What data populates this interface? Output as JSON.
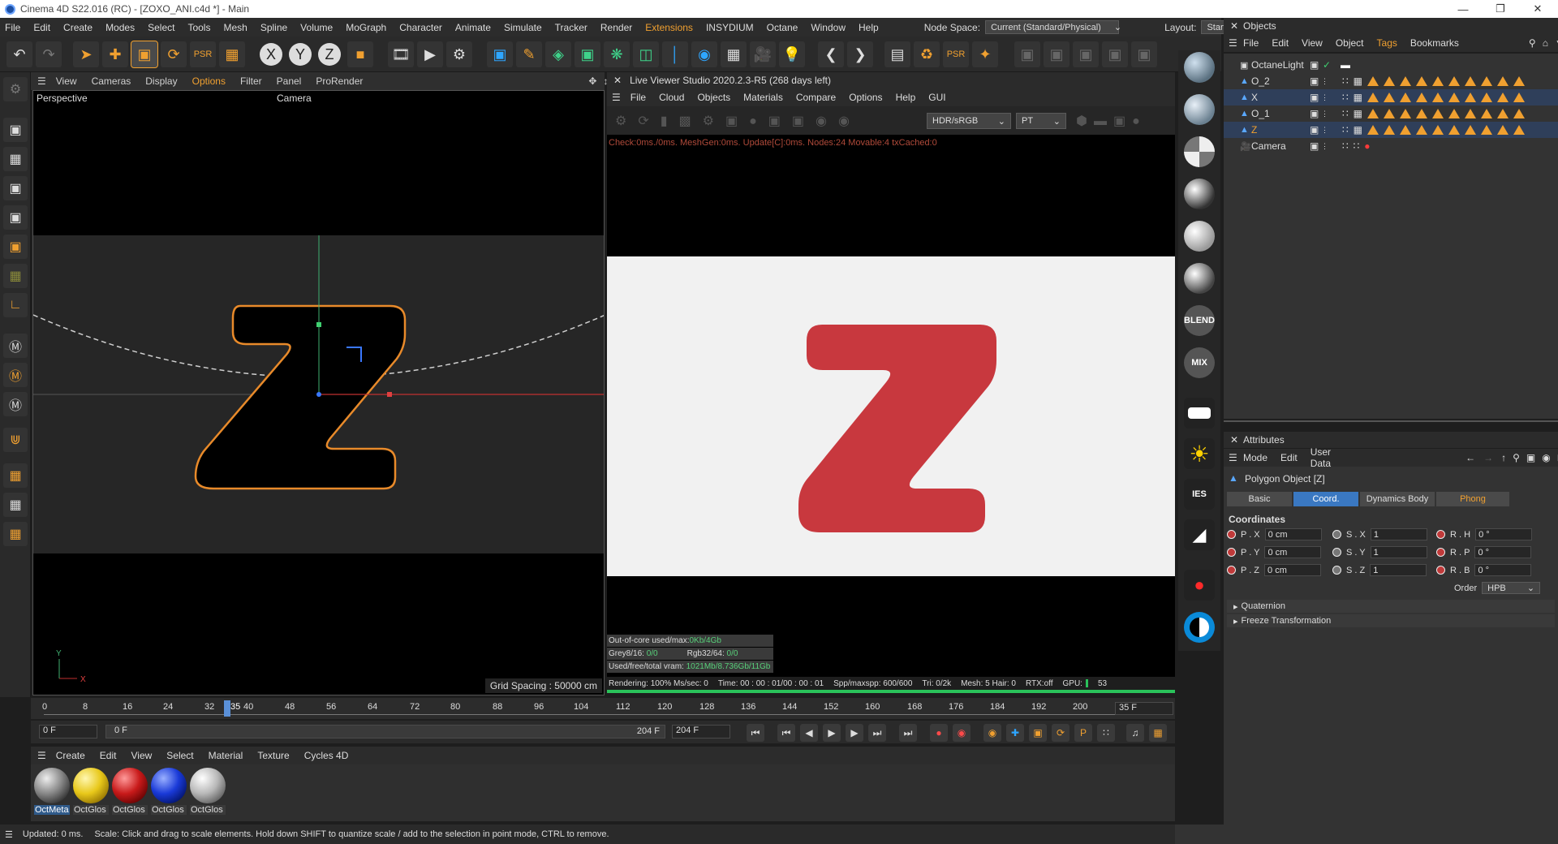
{
  "titlebar": {
    "title": "Cinema 4D S22.016 (RC) - [ZOXO_ANI.c4d *] - Main"
  },
  "menubar": {
    "items": [
      "File",
      "Edit",
      "Create",
      "Modes",
      "Select",
      "Tools",
      "Mesh",
      "Spline",
      "Volume",
      "MoGraph",
      "Character",
      "Animate",
      "Simulate",
      "Tracker",
      "Render",
      "Extensions",
      "INSYDIUM",
      "Octane",
      "Window",
      "Help"
    ],
    "node_space_label": "Node Space:",
    "node_space_value": "Current (Standard/Physical)",
    "layout_label": "Layout:",
    "layout_value": "Startup (User)"
  },
  "viewport": {
    "menu": [
      "View",
      "Cameras",
      "Display",
      "Options",
      "Filter",
      "Panel",
      "ProRender"
    ],
    "label": "Perspective",
    "camera": "Camera",
    "grid_spacing": "Grid Spacing : 50000 cm",
    "axis_y": "Y",
    "axis_x": "X"
  },
  "live_viewer": {
    "title": "Live Viewer Studio 2020.2.3-R5 (268 days left)",
    "menu": [
      "File",
      "Cloud",
      "Objects",
      "Materials",
      "Compare",
      "Options",
      "Help",
      "GUI"
    ],
    "color_mode": "HDR/sRGB",
    "kernel": "PT",
    "status": "Check:0ms./0ms. MeshGen:0ms. Update[C]:0ms. Nodes:24 Movable:4 txCached:0",
    "ooc_label": "Out-of-core used/max:",
    "ooc_value": "0Kb/4Gb",
    "grey_label": "Grey8/16:",
    "grey_value": "0/0",
    "rgb_label": "Rgb32/64:",
    "rgb_value": "0/0",
    "vram_label": "Used/free/total vram:",
    "vram_value": "1021Mb/8.736Gb/11Gb",
    "render_info": {
      "rendering": "Rendering: 100% Ms/sec: 0",
      "time": "Time: 00 : 00 : 01/00 : 00 : 01",
      "spp": "Spp/maxspp: 600/600",
      "tri": "Tri: 0/2k",
      "mesh": "Mesh: 5 Hair: 0",
      "rtx": "RTX:off",
      "gpu": "GPU:",
      "gpu_val": "53"
    },
    "render_letter": "Z",
    "render_color": "#c8383e"
  },
  "material_column": {
    "blend": "BLEND",
    "mix": "MIX",
    "ies": "IES"
  },
  "objects_panel": {
    "title": "Objects",
    "menu": [
      "File",
      "Edit",
      "View",
      "Object",
      "Tags",
      "Bookmarks"
    ],
    "items": [
      {
        "name": "OctaneLight"
      },
      {
        "name": "O_2"
      },
      {
        "name": "X"
      },
      {
        "name": "O_1"
      },
      {
        "name": "Z"
      },
      {
        "name": "Camera"
      }
    ]
  },
  "attributes": {
    "title": "Attributes",
    "menu": [
      "Mode",
      "Edit",
      "User Data"
    ],
    "object": "Polygon Object [Z]",
    "tabs": [
      "Basic",
      "Coord.",
      "Dynamics Body",
      "Phong"
    ],
    "section": "Coordinates",
    "coords": [
      {
        "p": "P . X",
        "pv": "0 cm",
        "s": "S . X",
        "sv": "1",
        "r": "R . H",
        "rv": "0 °"
      },
      {
        "p": "P . Y",
        "pv": "0 cm",
        "s": "S . Y",
        "sv": "1",
        "r": "R . P",
        "rv": "0 °"
      },
      {
        "p": "P . Z",
        "pv": "0 cm",
        "s": "S . Z",
        "sv": "1",
        "r": "R . B",
        "rv": "0 °"
      }
    ],
    "order_label": "Order",
    "order_value": "HPB",
    "quaternion": "Quaternion",
    "freeze": "Freeze Transformation"
  },
  "timeline": {
    "ticks": [
      "0",
      "8",
      "16",
      "24",
      "32",
      "40",
      "48",
      "56",
      "64",
      "72",
      "80",
      "88",
      "96",
      "104",
      "112",
      "120",
      "128",
      "136",
      "144",
      "152",
      "160",
      "168",
      "176",
      "184",
      "192",
      "200"
    ],
    "current_frame": "35",
    "frame_field": "35 F",
    "start": "0 F",
    "min": "0 F",
    "max": "204 F",
    "end": "204 F"
  },
  "material_manager": {
    "menu": [
      "Create",
      "Edit",
      "View",
      "Select",
      "Material",
      "Texture",
      "Cycles 4D"
    ],
    "materials": [
      {
        "name": "OctMeta",
        "color": "#9a9a9a"
      },
      {
        "name": "OctGlos",
        "color": "#e8c81a"
      },
      {
        "name": "OctGlos",
        "color": "#c81a1a"
      },
      {
        "name": "OctGlos",
        "color": "#1a3ad8"
      },
      {
        "name": "OctGlos",
        "color": "#b8b8b8"
      }
    ]
  },
  "statusbar": {
    "updated": "Updated: 0 ms.",
    "hint": "Scale: Click and drag to scale elements. Hold down SHIFT to quantize scale / add to the selection in point mode, CTRL to remove."
  }
}
